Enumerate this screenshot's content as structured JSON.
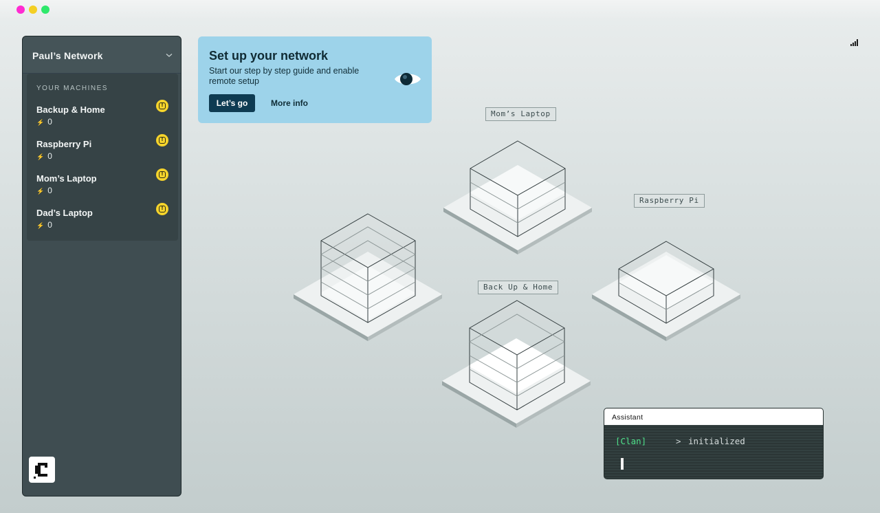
{
  "network": {
    "title": "Paul’s Network",
    "section_label": "YOUR MACHINES",
    "machines": [
      {
        "name": "Backup & Home",
        "count": "0"
      },
      {
        "name": "Raspberry Pi",
        "count": "0"
      },
      {
        "name": "Mom’s Laptop",
        "count": "0"
      },
      {
        "name": "Dad’s Laptop",
        "count": "0"
      }
    ]
  },
  "setup_card": {
    "title": "Set up your network",
    "description": "Start our step by step guide and enable remote setup",
    "primary_button": "Let’s go",
    "secondary_button": "More info"
  },
  "canvas": {
    "labels": {
      "moms_laptop": "Mom’s Laptop",
      "raspberry_pi": "Raspberry Pi",
      "backup_home": "Back Up & Home"
    }
  },
  "assistant": {
    "title": "Assistant",
    "tag": "[Clan]",
    "prompt": ">",
    "message": "initialized"
  },
  "colors": {
    "accent_dark": "#0e3b52",
    "card_blue": "#9dd3ea",
    "warning": "#f6d42b",
    "terminal_green": "#4fe08a"
  }
}
